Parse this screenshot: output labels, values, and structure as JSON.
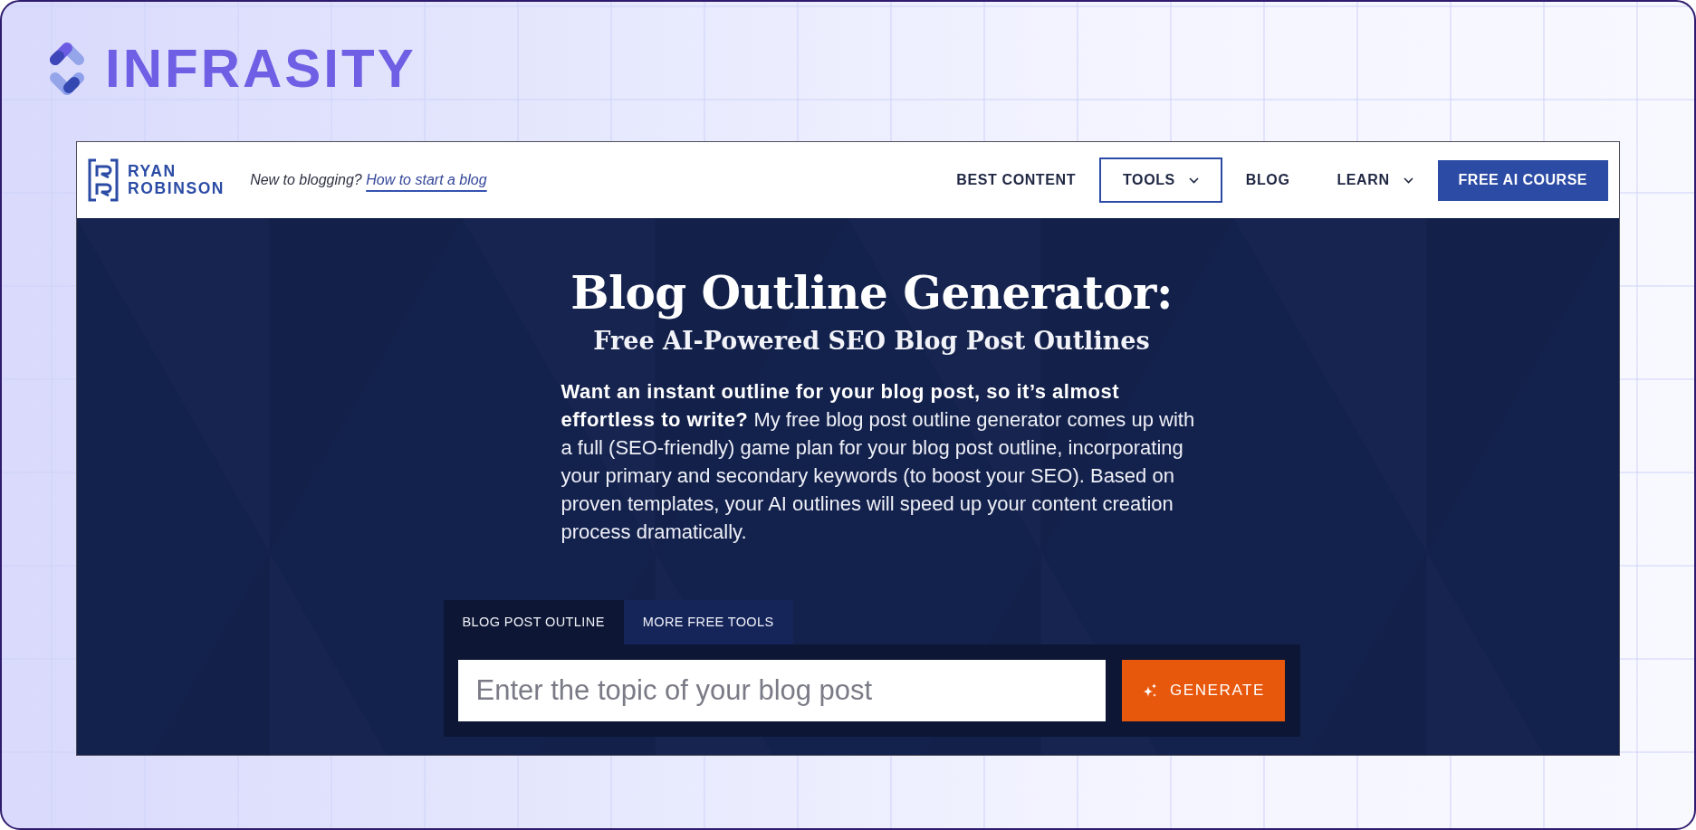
{
  "brand": {
    "name": "INFRASITY"
  },
  "site_header": {
    "logo_lines": [
      "RYAN",
      "ROBINSON"
    ],
    "tagline": "New to blogging?",
    "tagline_link": "How to start a blog",
    "nav": [
      {
        "label": "BEST CONTENT",
        "has_menu": false,
        "selected": false
      },
      {
        "label": "TOOLS",
        "has_menu": true,
        "selected": true
      },
      {
        "label": "BLOG",
        "has_menu": false,
        "selected": false
      },
      {
        "label": "LEARN",
        "has_menu": true,
        "selected": false
      }
    ],
    "cta_button": "FREE AI COURSE"
  },
  "hero": {
    "title": "Blog Outline Generator:",
    "subtitle": "Free AI-Powered SEO Blog Post Outlines",
    "intro": "**Want an instant outline for your blog post, so it’s almost effortless to write?** My free blog post outline generator comes up with a full (SEO-friendly) game plan for your blog post outline, incorporating your primary and secondary keywords (to boost your SEO). Based on proven templates, your AI outlines will speed up your content creation process dramatically."
  },
  "tool": {
    "tabs": [
      {
        "label": "BLOG POST OUTLINE",
        "selected": true
      },
      {
        "label": "MORE FREE TOOLS",
        "selected": false
      }
    ],
    "input": {
      "placeholder": "Enter the topic of your blog post"
    },
    "button": "GENERATE"
  }
}
